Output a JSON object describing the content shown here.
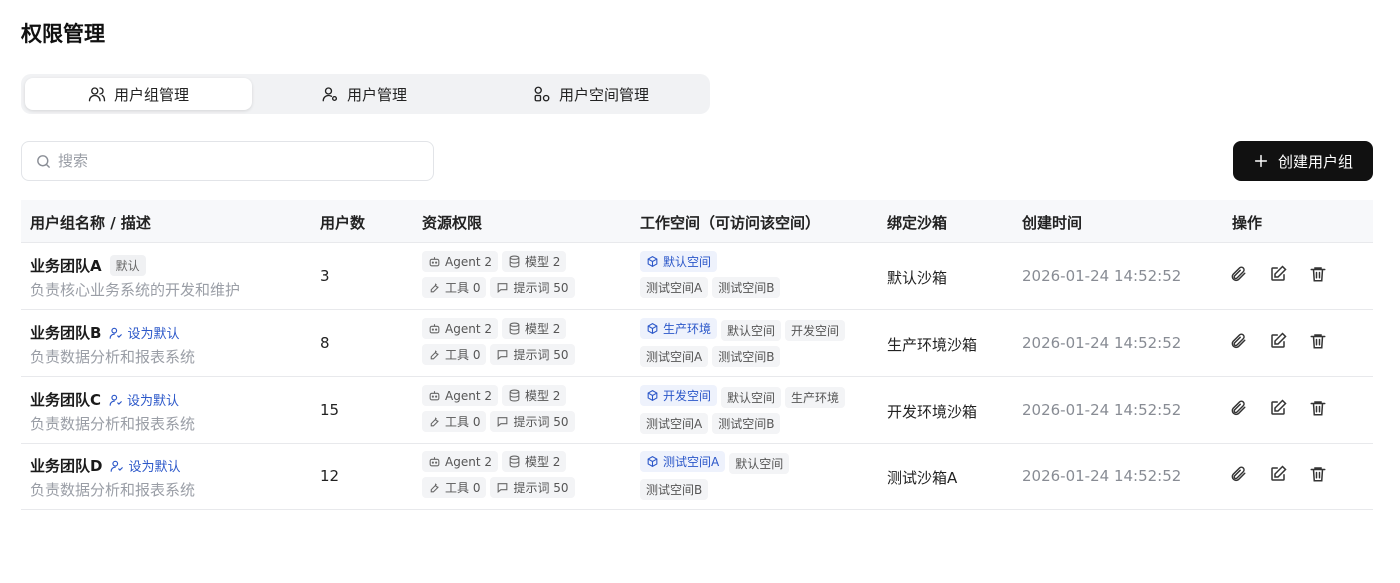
{
  "page": {
    "title": "权限管理"
  },
  "tabs": [
    {
      "label": "用户组管理",
      "icon": "users-icon",
      "active": true
    },
    {
      "label": "用户管理",
      "icon": "user-settings-icon",
      "active": false
    },
    {
      "label": "用户空间管理",
      "icon": "shapes-icon",
      "active": false
    }
  ],
  "search": {
    "placeholder": "搜索"
  },
  "create_button": {
    "label": "创建用户组"
  },
  "table": {
    "columns": [
      "用户组名称 / 描述",
      "用户数",
      "资源权限",
      "工作空间（可访问该空间）",
      "绑定沙箱",
      "创建时间",
      "操作"
    ],
    "set_default_label": "设为默认",
    "default_tag": "默认",
    "rows": [
      {
        "name": "业务团队A",
        "is_default": true,
        "desc": "负责核心业务系统的开发和维护",
        "users": "3",
        "agent": "Agent 2",
        "model": "模型 2",
        "tools": "工具 0",
        "prompts": "提示词 50",
        "ws_main": "默认空间",
        "ws_others": [
          "测试空间A",
          "测试空间B"
        ],
        "sandbox": "默认沙箱",
        "created": "2026-01-24 14:52:52"
      },
      {
        "name": "业务团队B",
        "is_default": false,
        "desc": "负责数据分析和报表系统",
        "users": "8",
        "agent": "Agent 2",
        "model": "模型 2",
        "tools": "工具 0",
        "prompts": "提示词 50",
        "ws_main": "生产环境",
        "ws_others": [
          "默认空间",
          "开发空间",
          "测试空间A",
          "测试空间B"
        ],
        "sandbox": "生产环境沙箱",
        "created": "2026-01-24 14:52:52"
      },
      {
        "name": "业务团队C",
        "is_default": false,
        "desc": "负责数据分析和报表系统",
        "users": "15",
        "agent": "Agent 2",
        "model": "模型 2",
        "tools": "工具 0",
        "prompts": "提示词 50",
        "ws_main": "开发空间",
        "ws_others": [
          "默认空间",
          "生产环境",
          "测试空间A",
          "测试空间B"
        ],
        "sandbox": "开发环境沙箱",
        "created": "2026-01-24 14:52:52"
      },
      {
        "name": "业务团队D",
        "is_default": false,
        "desc": "负责数据分析和报表系统",
        "users": "12",
        "agent": "Agent 2",
        "model": "模型 2",
        "tools": "工具 0",
        "prompts": "提示词 50",
        "ws_main": "测试空间A",
        "ws_others": [
          "默认空间",
          "测试空间B"
        ],
        "sandbox": "测试沙箱A",
        "created": "2026-01-24 14:52:52"
      }
    ]
  },
  "colors": {
    "primary_button": "#111111",
    "link": "#2b57c9",
    "workspace_highlight_bg": "#eef2fc"
  }
}
